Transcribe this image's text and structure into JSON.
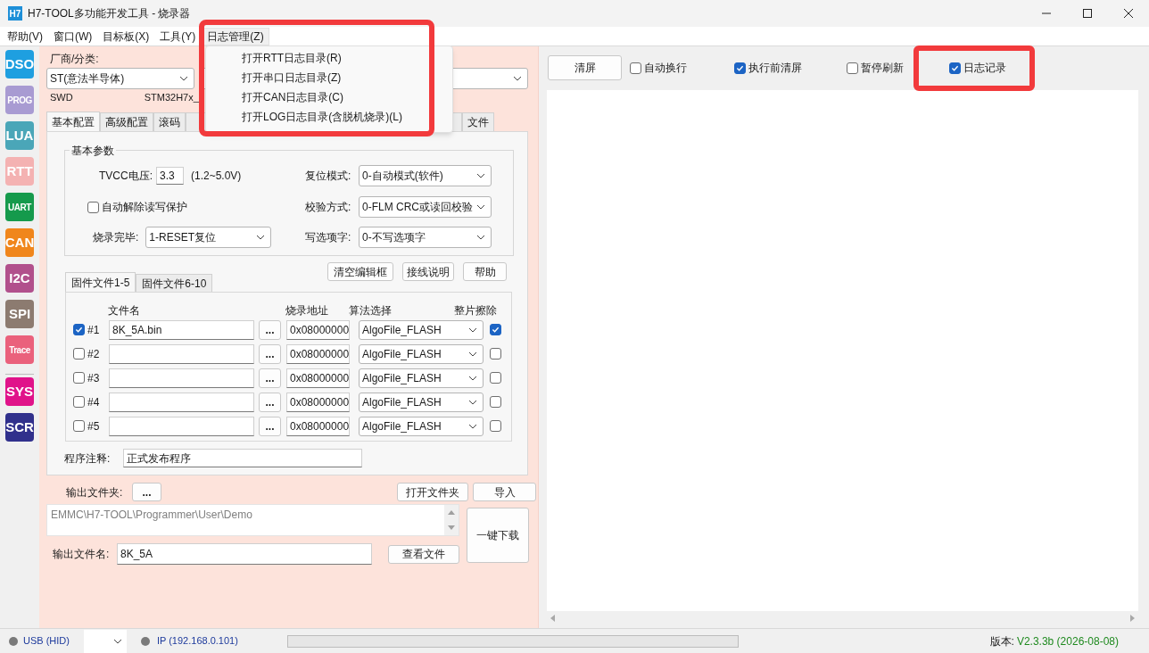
{
  "window": {
    "title": "H7-TOOL多功能开发工具 - 烧录器",
    "app_icon": "H7"
  },
  "menu_bar": [
    {
      "label": "帮助(V)",
      "selected": false
    },
    {
      "label": "窗口(W)",
      "selected": false
    },
    {
      "label": "目标板(X)",
      "selected": false
    },
    {
      "label": "工具(Y)",
      "selected": false
    },
    {
      "label": "日志管理(Z)",
      "selected": true
    }
  ],
  "open_menu": {
    "items": [
      "打开RTT日志目录(R)",
      "打开串口日志目录(Z)",
      "打开CAN日志目录(C)",
      "打开LOG日志目录(含脱机烧录)(L)"
    ]
  },
  "sidebar": {
    "groups": [
      [
        {
          "label": "DSO",
          "color": "#1e9fe0"
        },
        {
          "label": "PROG",
          "color": "#a89bd2"
        },
        {
          "label": "LUA",
          "color": "#4aa6b8"
        },
        {
          "label": "RTT",
          "color": "#f4b2b2"
        },
        {
          "label": "UART",
          "color": "#159a4c"
        },
        {
          "label": "CAN",
          "color": "#f0861c"
        },
        {
          "label": "I2C",
          "color": "#b1508c"
        },
        {
          "label": "SPI",
          "color": "#8c7b70"
        },
        {
          "label": "Trace",
          "color": "#ea617c"
        }
      ],
      [
        {
          "label": "SYS",
          "color": "#e0138a"
        },
        {
          "label": "SCR",
          "color": "#30308c"
        }
      ]
    ]
  },
  "vendor": {
    "label": "厂商/分类:",
    "value": "ST(意法半导体)"
  },
  "interface": "SWD",
  "device": "STM32H7x_",
  "tabs": [
    {
      "label": "基本配置",
      "selected": true
    },
    {
      "label": "高级配置",
      "selected": false
    },
    {
      "label": "滚码",
      "selected": false
    },
    {
      "label": "文件",
      "selected": false
    }
  ],
  "basic_params": {
    "title": "基本参数",
    "tvcc": {
      "label": "TVCC电压:",
      "value": "3.3",
      "range": "(1.2~5.0V)"
    },
    "auto_unprotect": {
      "label": "自动解除读写保护",
      "checked": false
    },
    "after_program": {
      "label": "烧录完毕:",
      "value": "1-RESET复位"
    },
    "reset_mode": {
      "label": "复位模式:",
      "value": "0-自动模式(软件)"
    },
    "verify": {
      "label": "校验方式:",
      "value": "0-FLM CRC或读回校验"
    },
    "option_bytes": {
      "label": "写选项字:",
      "value": "0-不写选项字"
    }
  },
  "buttons": [
    "清空编辑框",
    "接线说明",
    "帮助"
  ],
  "file_tabs": [
    {
      "label": "固件文件1-5",
      "selected": true
    },
    {
      "label": "固件文件6-10",
      "selected": false
    }
  ],
  "files": {
    "columns": [
      "文件名",
      "烧录地址",
      "算法选择",
      "整片擦除"
    ],
    "rows": [
      {
        "enabled": true,
        "index": "#1",
        "file": "8K_5A.bin",
        "browse": "...",
        "address": "0x08000000",
        "algorithm": "AlgoFile_FLASH",
        "erase_chip": true
      },
      {
        "enabled": false,
        "index": "#2",
        "browse": "...",
        "address": "0x08000000",
        "algorithm": "AlgoFile_FLASH",
        "erase_chip": false
      },
      {
        "enabled": false,
        "index": "#3",
        "browse": "...",
        "address": "0x08000000",
        "algorithm": "AlgoFile_FLASH",
        "erase_chip": false
      },
      {
        "enabled": false,
        "index": "#4",
        "browse": "...",
        "address": "0x08000000",
        "algorithm": "AlgoFile_FLASH",
        "erase_chip": false
      },
      {
        "enabled": false,
        "index": "#5",
        "browse": "...",
        "address": "0x08000000",
        "algorithm": "AlgoFile_FLASH",
        "erase_chip": false
      }
    ]
  },
  "comment": {
    "label": "程序注释:",
    "value": "正式发布程序"
  },
  "output": {
    "folder_label": "输出文件夹:",
    "folder_button": "...",
    "open_folder": "打开文件夹",
    "import": "导入",
    "path": "EMMC\\H7-TOOL\\Programmer\\User\\Demo",
    "download": "一键下载",
    "name_label": "输出文件名:",
    "name": "8K_5A",
    "view": "查看文件"
  },
  "log": {
    "clear": "清屏",
    "options": [
      {
        "label": "自动换行",
        "checked": false
      },
      {
        "label": "执行前清屏",
        "checked": true
      },
      {
        "label": "暂停刷新",
        "checked": false
      },
      {
        "label": "日志记录",
        "checked": true
      }
    ]
  },
  "status_bar": {
    "usb": "USB (HID)",
    "ip": "IP (192.168.0.101)",
    "progress": {
      "level": 0
    },
    "version_label": "版本:",
    "version": "V2.3.3b (2026-08-08)"
  }
}
